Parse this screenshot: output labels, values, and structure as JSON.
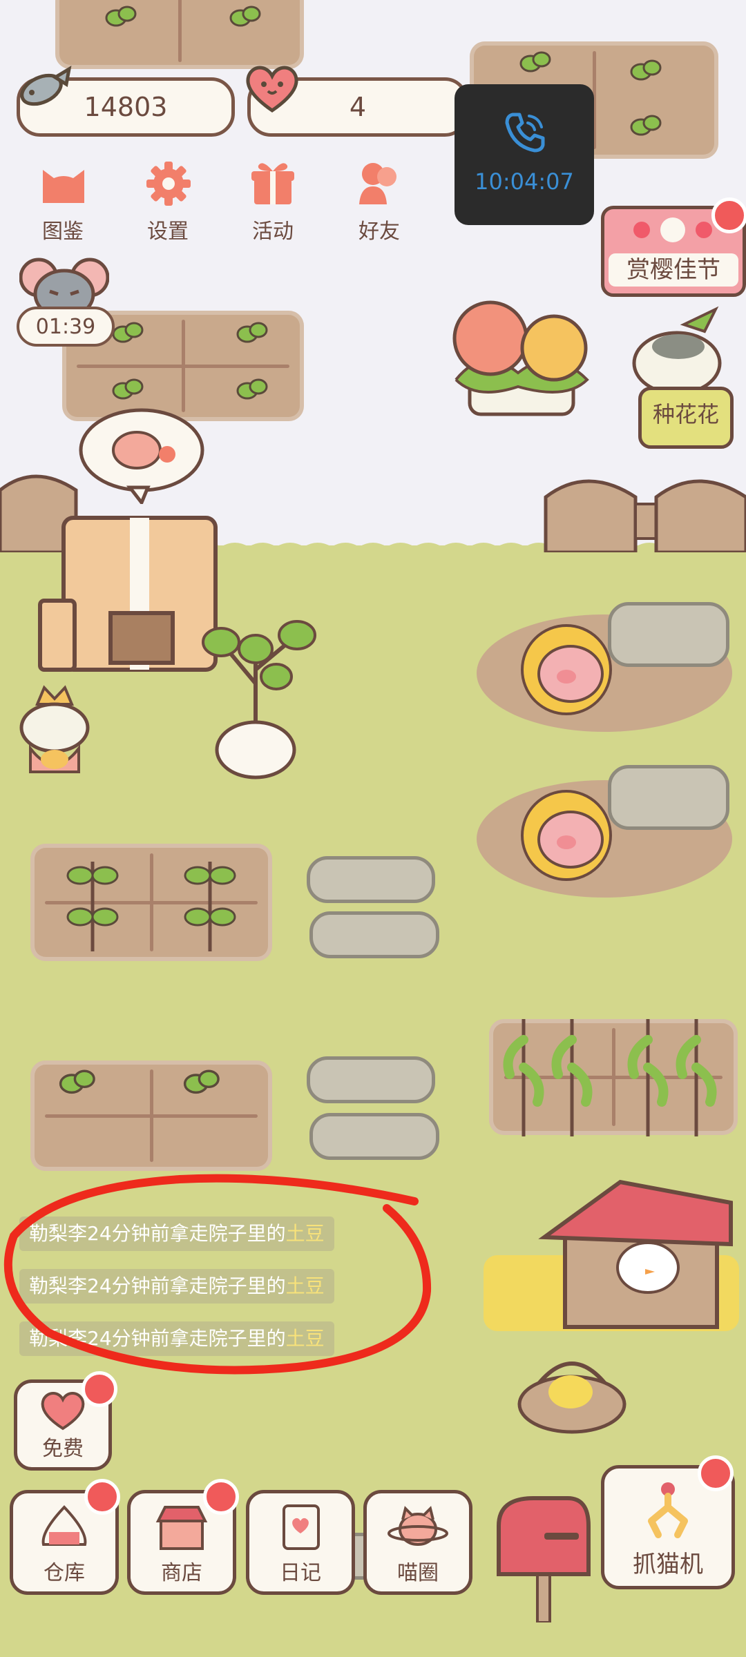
{
  "resources": {
    "fish_count": "14803",
    "heart_count": "4"
  },
  "call_overlay": {
    "time": "10:04:07",
    "icon": "phone-icon"
  },
  "top_menu": [
    {
      "label": "图鉴",
      "icon": "cat-head-icon"
    },
    {
      "label": "设置",
      "icon": "gear-icon"
    },
    {
      "label": "活动",
      "icon": "gift-icon"
    },
    {
      "label": "好友",
      "icon": "friends-icon"
    }
  ],
  "mouse_timer": "01:39",
  "event_sign": "赏樱佳节",
  "plant_sign": "种花花",
  "activity_log": [
    {
      "user": "勒梨李",
      "mid": "24分钟前拿走院子里的",
      "item": "土豆"
    },
    {
      "user": "勒梨李",
      "mid": "24分钟前拿走院子里的",
      "item": "土豆"
    },
    {
      "user": "勒梨李",
      "mid": "24分钟前拿走院子里的",
      "item": "土豆"
    }
  ],
  "free_button": "免费",
  "bottom_nav": [
    {
      "label": "仓库",
      "badge": true
    },
    {
      "label": "商店",
      "badge": true
    },
    {
      "label": "日记",
      "badge": false
    },
    {
      "label": "喵圈",
      "badge": false
    }
  ],
  "claw_machine": "抓猫机",
  "colors": {
    "lawn": "#d3d78c",
    "soil": "#c9a98c",
    "outline": "#6b4a3f",
    "badge": "#f05a5a",
    "annotation": "#ee2a1c",
    "call_bg": "#2b2b2b",
    "call_blue": "#3a8fd6"
  }
}
